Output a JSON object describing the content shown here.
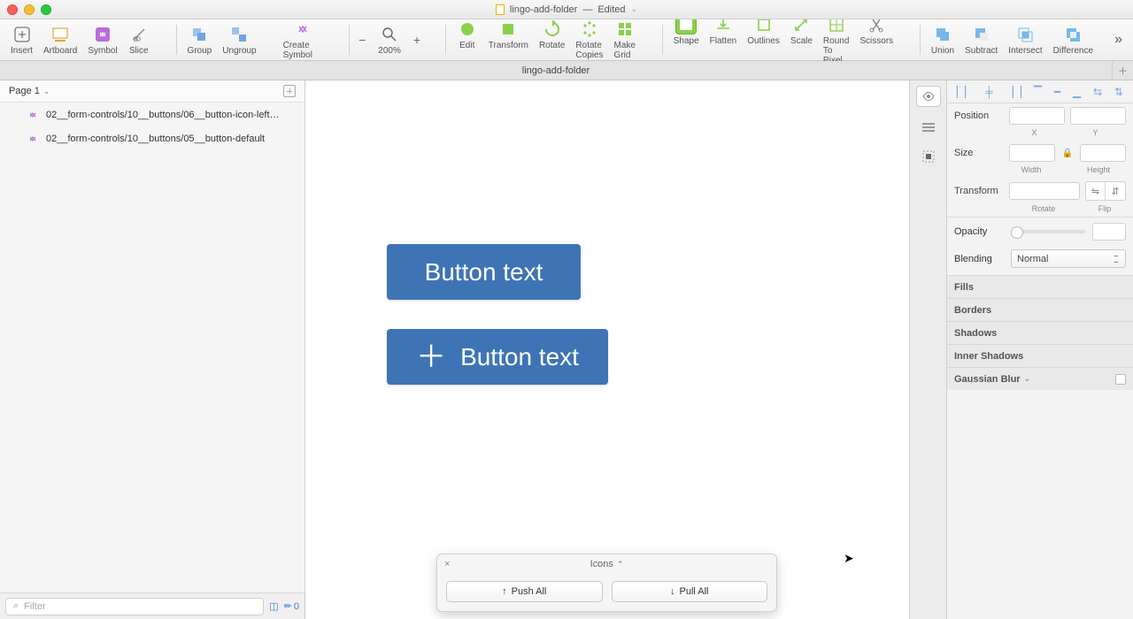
{
  "window": {
    "filename": "lingo-add-folder",
    "status": "Edited"
  },
  "toolbar": {
    "insert": "Insert",
    "artboard": "Artboard",
    "symbol": "Symbol",
    "slice": "Slice",
    "group": "Group",
    "ungroup": "Ungroup",
    "create_symbol": "Create Symbol",
    "zoom": "200%",
    "edit": "Edit",
    "transform": "Transform",
    "rotate": "Rotate",
    "rotate_copies": "Rotate Copies",
    "make_grid": "Make Grid",
    "shape": "Shape",
    "flatten": "Flatten",
    "outlines": "Outlines",
    "scale": "Scale",
    "round_to_pixel": "Round To Pixel",
    "scissors": "Scissors",
    "union": "Union",
    "subtract": "Subtract",
    "intersect": "Intersect",
    "difference": "Difference"
  },
  "tab": "lingo-add-folder",
  "pages": {
    "current": "Page 1"
  },
  "layers": [
    "02__form-controls/10__buttons/06__button-icon-left…",
    "02__form-controls/10__buttons/05__button-default"
  ],
  "filter_placeholder": "Filter",
  "footer_count": "0",
  "canvas": {
    "button1": "Button text",
    "button2": "Button text"
  },
  "icons_panel": {
    "title": "Icons",
    "push": "Push All",
    "pull": "Pull All"
  },
  "inspector": {
    "position": "Position",
    "x": "X",
    "y": "Y",
    "size": "Size",
    "width": "Width",
    "height": "Height",
    "transform": "Transform",
    "rotate": "Rotate",
    "flip": "Flip",
    "opacity": "Opacity",
    "blending": "Blending",
    "blend_value": "Normal",
    "fills": "Fills",
    "borders": "Borders",
    "shadows": "Shadows",
    "inner_shadows": "Inner Shadows",
    "gaussian": "Gaussian Blur"
  }
}
